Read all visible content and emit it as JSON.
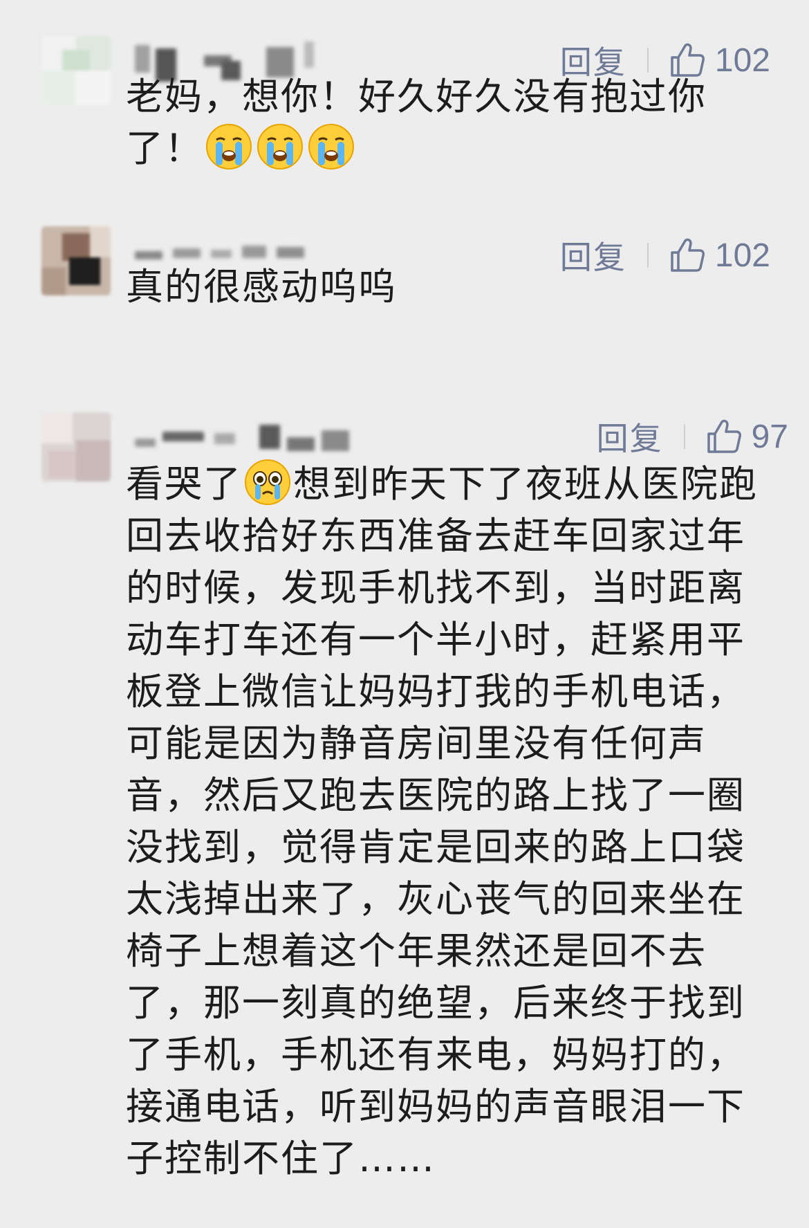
{
  "comments": [
    {
      "reply_label": "回复",
      "like_count": "102",
      "text_before": "老妈，想你！好久好久没有抱过你了！",
      "emoji_name": "crying-face-icon",
      "text_after": ""
    },
    {
      "reply_label": "回复",
      "like_count": "102",
      "text_before": "真的很感动呜呜",
      "text_after": ""
    },
    {
      "reply_label": "回复",
      "like_count": "97",
      "text_before": "看哭了",
      "emoji_name": "teary-eyed-face-icon",
      "text_after": "想到昨天下了夜班从医院跑回去收拾好东西准备去赶车回家过年的时候，发现手机找不到，当时距离动车打车还有一个半小时，赶紧用平板登上微信让妈妈打我的手机电话，可能是因为静音房间里没有任何声音，然后又跑去医院的路上找了一圈没找到，觉得肯定是回来的路上口袋太浅掉出来了，灰心丧气的回来坐在椅子上想着这个年果然还是回不去了，那一刻真的绝望，后来终于找到了手机，手机还有来电，妈妈打的，接通电话，听到妈妈的声音眼泪一下子控制不住了……"
    }
  ],
  "colors": {
    "background": "#ededed",
    "action_text": "#6f7a96",
    "body_text": "#1c1c1c"
  }
}
